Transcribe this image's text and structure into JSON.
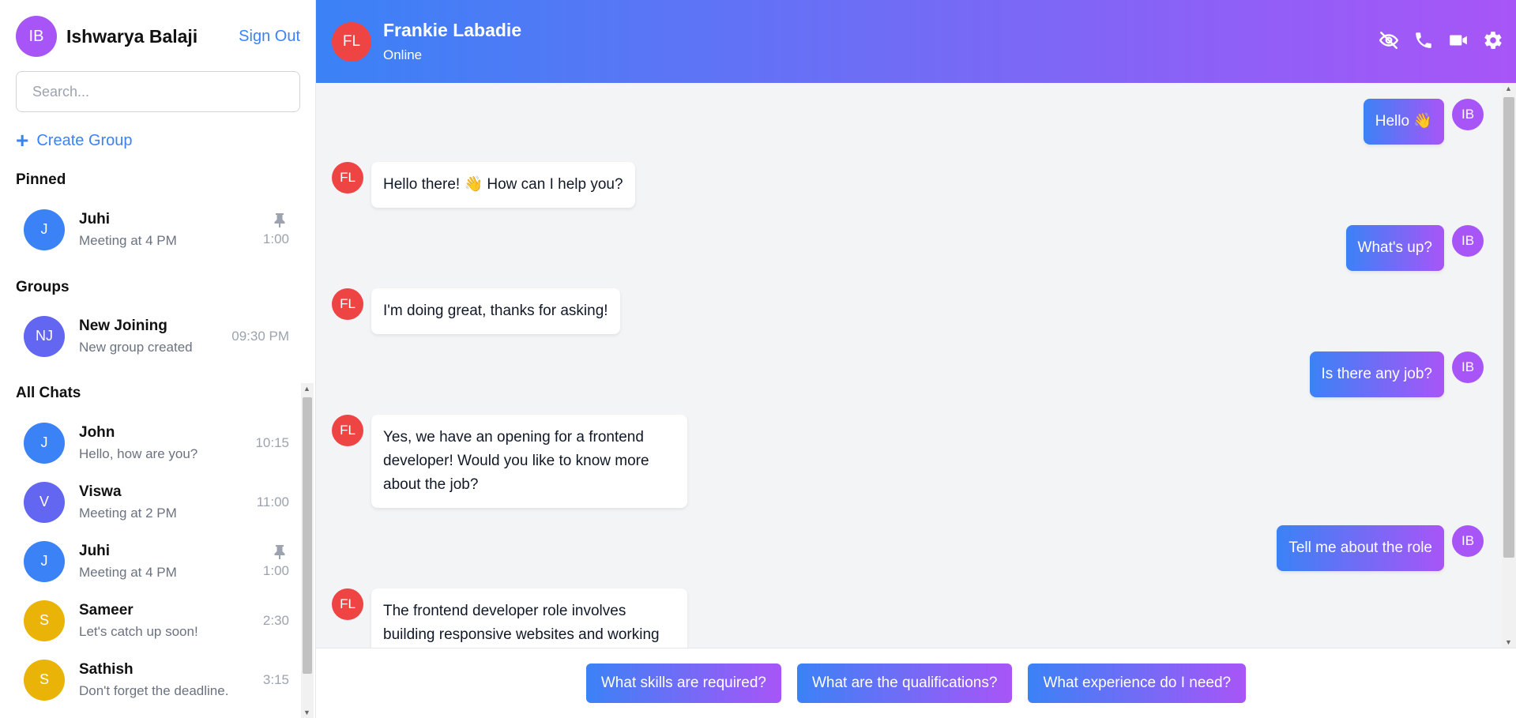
{
  "user": {
    "initials": "IB",
    "name": "Ishwarya Balaji",
    "avatar_color": "#a855f7"
  },
  "sidebar": {
    "sign_out_label": "Sign Out",
    "search_placeholder": "Search...",
    "create_group_label": "Create Group",
    "pinned_title": "Pinned",
    "groups_title": "Groups",
    "all_chats_title": "All Chats",
    "pinned": [
      {
        "initials": "J",
        "name": "Juhi",
        "preview": "Meeting at 4 PM",
        "time": "1:00",
        "color": "#3b82f6",
        "pinned": true
      }
    ],
    "groups": [
      {
        "initials": "NJ",
        "name": "New Joining",
        "preview": "New group created",
        "time": "09:30 PM",
        "color": "#6366f1"
      }
    ],
    "all_chats": [
      {
        "initials": "J",
        "name": "John",
        "preview": "Hello, how are you?",
        "time": "10:15",
        "color": "#3b82f6",
        "pinned": false
      },
      {
        "initials": "V",
        "name": "Viswa",
        "preview": "Meeting at 2 PM",
        "time": "11:00",
        "color": "#6366f1",
        "pinned": false
      },
      {
        "initials": "J",
        "name": "Juhi",
        "preview": "Meeting at 4 PM",
        "time": "1:00",
        "color": "#3b82f6",
        "pinned": true
      },
      {
        "initials": "S",
        "name": "Sameer",
        "preview": "Let's catch up soon!",
        "time": "2:30",
        "color": "#eab308",
        "pinned": false
      },
      {
        "initials": "S",
        "name": "Sathish",
        "preview": "Don't forget the deadline.",
        "time": "3:15",
        "color": "#eab308",
        "pinned": false
      }
    ]
  },
  "header": {
    "initials": "FL",
    "name": "Frankie Labadie",
    "status": "Online",
    "avatar_color": "#ef4444",
    "icons": [
      "eye-off-icon",
      "phone-icon",
      "video-icon",
      "gear-icon"
    ]
  },
  "messages": [
    {
      "from": "me",
      "initials": "IB",
      "text": "Hello 👋"
    },
    {
      "from": "them",
      "initials": "FL",
      "text": "Hello there! 👋 How can I help you?"
    },
    {
      "from": "me",
      "initials": "IB",
      "text": "What's up?"
    },
    {
      "from": "them",
      "initials": "FL",
      "text": "I'm doing great, thanks for asking!"
    },
    {
      "from": "me",
      "initials": "IB",
      "text": "Is there any job?"
    },
    {
      "from": "them",
      "initials": "FL",
      "text": "Yes, we have an opening for a frontend developer! Would you like to know more about the job?"
    },
    {
      "from": "me",
      "initials": "IB",
      "text": "Tell me about the role"
    },
    {
      "from": "them",
      "initials": "FL",
      "text": "The frontend developer role involves building responsive websites and working"
    }
  ],
  "suggestions": [
    "What skills are required?",
    "What are the qualifications?",
    "What experience do I need?"
  ],
  "colors": {
    "gradient_start": "#3b82f6",
    "gradient_end": "#a855f7",
    "accent": "#3b82f6"
  }
}
